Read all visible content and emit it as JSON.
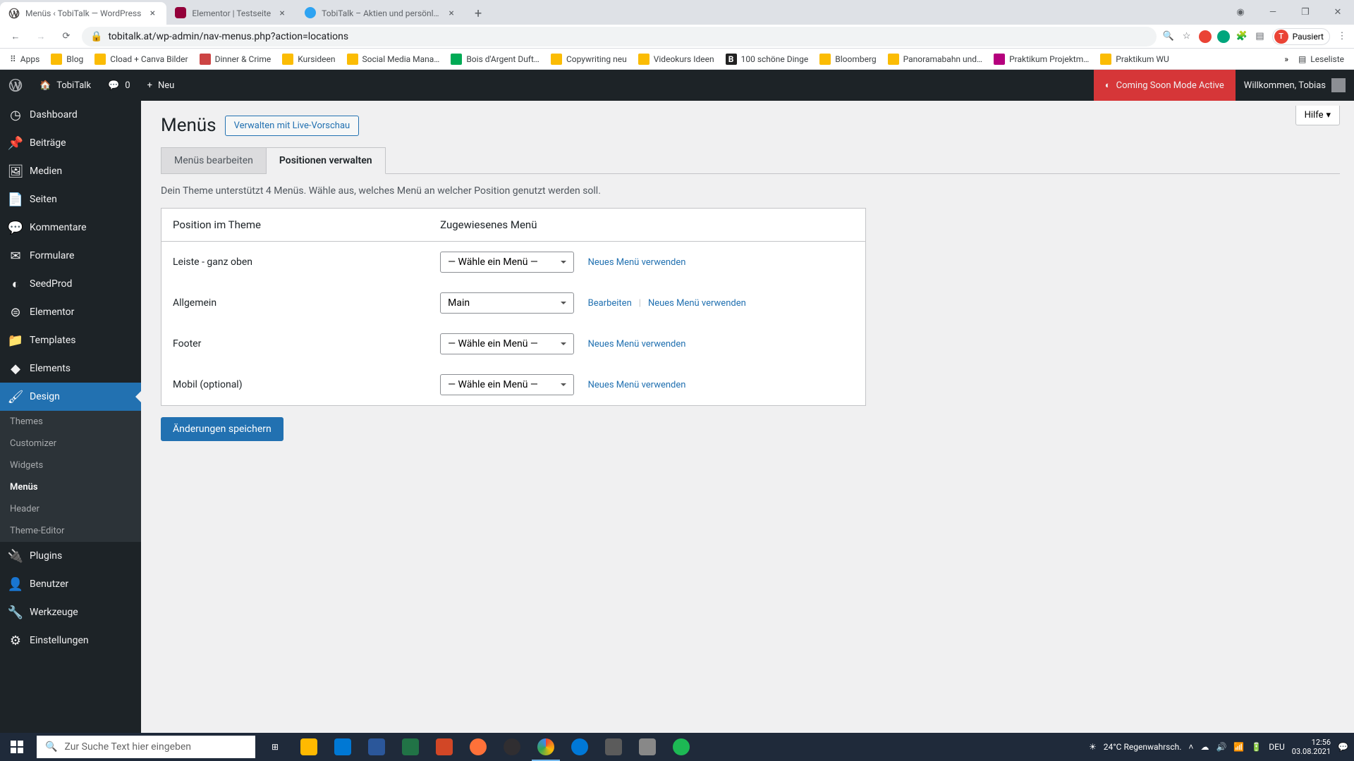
{
  "browser": {
    "tabs": [
      {
        "title": "Menüs ‹ TobiTalk — WordPress",
        "active": true
      },
      {
        "title": "Elementor | Testseite",
        "active": false
      },
      {
        "title": "TobiTalk – Aktien und persönlich…",
        "active": false
      }
    ],
    "url": "tobitalk.at/wp-admin/nav-menus.php?action=locations",
    "profile": {
      "initial": "T",
      "label": "Pausiert"
    },
    "bookmarks": [
      "Apps",
      "Blog",
      "Cload + Canva Bilder",
      "Dinner & Crime",
      "Kursideen",
      "Social Media Mana…",
      "Bois d'Argent Duft…",
      "Copywriting neu",
      "Videokurs Ideen",
      "100 schöne Dinge",
      "Bloomberg",
      "Panoramabahn und…",
      "Praktikum Projektm…",
      "Praktikum WU"
    ],
    "bookmarks_overflow": "»",
    "readlist": "Leseliste"
  },
  "wpbar": {
    "site": "TobiTalk",
    "comments": "0",
    "new": "Neu",
    "coming_soon": "Coming Soon Mode Active",
    "welcome": "Willkommen, Tobias"
  },
  "sidebar": {
    "items": [
      {
        "label": "Dashboard"
      },
      {
        "label": "Beiträge"
      },
      {
        "label": "Medien"
      },
      {
        "label": "Seiten"
      },
      {
        "label": "Kommentare"
      },
      {
        "label": "Formulare"
      },
      {
        "label": "SeedProd"
      },
      {
        "label": "Elementor"
      },
      {
        "label": "Templates"
      },
      {
        "label": "Elements"
      },
      {
        "label": "Design"
      },
      {
        "label": "Plugins"
      },
      {
        "label": "Benutzer"
      },
      {
        "label": "Werkzeuge"
      },
      {
        "label": "Einstellungen"
      }
    ],
    "design_sub": [
      "Themes",
      "Customizer",
      "Widgets",
      "Menüs",
      "Header",
      "Theme-Editor"
    ]
  },
  "page": {
    "title": "Menüs",
    "action": "Verwalten mit Live-Vorschau",
    "help": "Hilfe",
    "tabs": {
      "edit": "Menüs bearbeiten",
      "locations": "Positionen verwalten"
    },
    "description": "Dein Theme unterstützt 4 Menüs. Wähle aus, welches Menü an welcher Position genutzt werden soll.",
    "th_location": "Position im Theme",
    "th_assigned": "Zugewiesenes Menü",
    "placeholder_option": "— Wähle ein Menü —",
    "rows": [
      {
        "location": "Leiste - ganz oben",
        "selected": "— Wähle ein Menü —",
        "edit": null,
        "new": "Neues Menü verwenden"
      },
      {
        "location": "Allgemein",
        "selected": "Main",
        "edit": "Bearbeiten",
        "new": "Neues Menü verwenden"
      },
      {
        "location": "Footer",
        "selected": "— Wähle ein Menü —",
        "edit": null,
        "new": "Neues Menü verwenden"
      },
      {
        "location": "Mobil (optional)",
        "selected": "— Wähle ein Menü —",
        "edit": null,
        "new": "Neues Menü verwenden"
      }
    ],
    "submit": "Änderungen speichern"
  },
  "taskbar": {
    "search_placeholder": "Zur Suche Text hier eingeben",
    "weather": "24°C  Regenwahrsch.",
    "lang": "DEU",
    "time": "12:56",
    "date": "03.08.2021"
  }
}
